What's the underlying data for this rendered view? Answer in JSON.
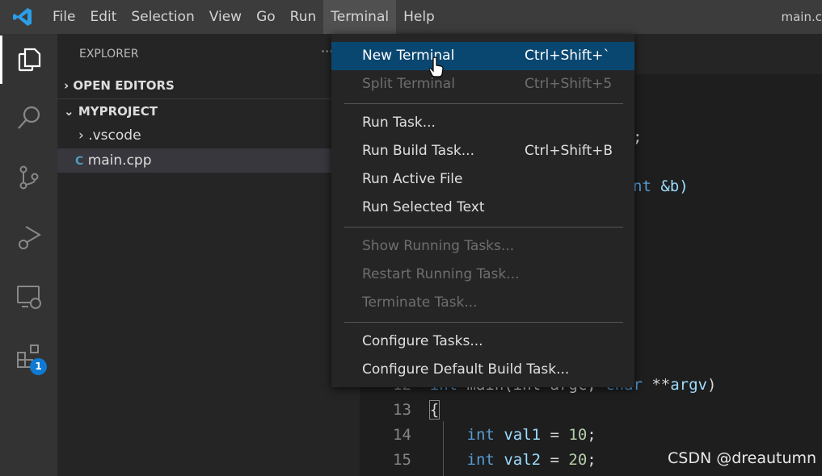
{
  "menubar": {
    "items": [
      "File",
      "Edit",
      "Selection",
      "View",
      "Go",
      "Run",
      "Terminal",
      "Help"
    ],
    "active": "Terminal",
    "window_title": "main.c"
  },
  "activity_bar": {
    "items": [
      "files-icon",
      "search-icon",
      "source-control-icon",
      "run-debug-icon",
      "remote-explorer-icon",
      "extensions-icon"
    ],
    "extensions_badge": "1",
    "badge_color": "#0e7ad3"
  },
  "sidebar": {
    "title": "EXPLORER",
    "more": "···",
    "open_editors": "OPEN EDITORS",
    "project": "MYPROJECT",
    "folders": [
      ".vscode"
    ],
    "files": [
      "main.cpp"
    ]
  },
  "terminal_menu": {
    "items": [
      {
        "label": "New Terminal",
        "shortcut": "Ctrl+Shift+`",
        "state": "highlighted"
      },
      {
        "label": "Split Terminal",
        "shortcut": "Ctrl+Shift+5",
        "state": "disabled"
      },
      {
        "label": "Run Task...",
        "shortcut": "",
        "state": "enabled"
      },
      {
        "label": "Run Build Task...",
        "shortcut": "Ctrl+Shift+B",
        "state": "enabled"
      },
      {
        "label": "Run Active File",
        "shortcut": "",
        "state": "enabled"
      },
      {
        "label": "Run Selected Text",
        "shortcut": "",
        "state": "enabled"
      },
      {
        "label": "Show Running Tasks...",
        "shortcut": "",
        "state": "disabled"
      },
      {
        "label": "Restart Running Task...",
        "shortcut": "",
        "state": "disabled"
      },
      {
        "label": "Terminate Task...",
        "shortcut": "",
        "state": "disabled"
      },
      {
        "label": "Configure Tasks...",
        "shortcut": "",
        "state": "enabled"
      },
      {
        "label": "Configure Default Build Task...",
        "shortcut": "",
        "state": "enabled"
      }
    ]
  },
  "editor": {
    "fragments": {
      "semicolon": ";",
      "int_ref_b": "nt",
      "amp_b": "&b)"
    },
    "line12": {
      "num": "12",
      "int": "int",
      "rest": " main(int argc, ",
      "char": "char",
      "stars": " **",
      "argv": "argv",
      ")": ")"
    },
    "line13": {
      "num": "13",
      "text": "{"
    },
    "line14": {
      "num": "14",
      "type": "int",
      "name": "val1",
      "eq": " = ",
      "value": "10",
      "end": ";"
    },
    "line15": {
      "num": "15",
      "type": "int",
      "name": "val2",
      "eq": " = ",
      "value": "20",
      "end": ";"
    }
  },
  "watermark": "CSDN @dreautumn"
}
